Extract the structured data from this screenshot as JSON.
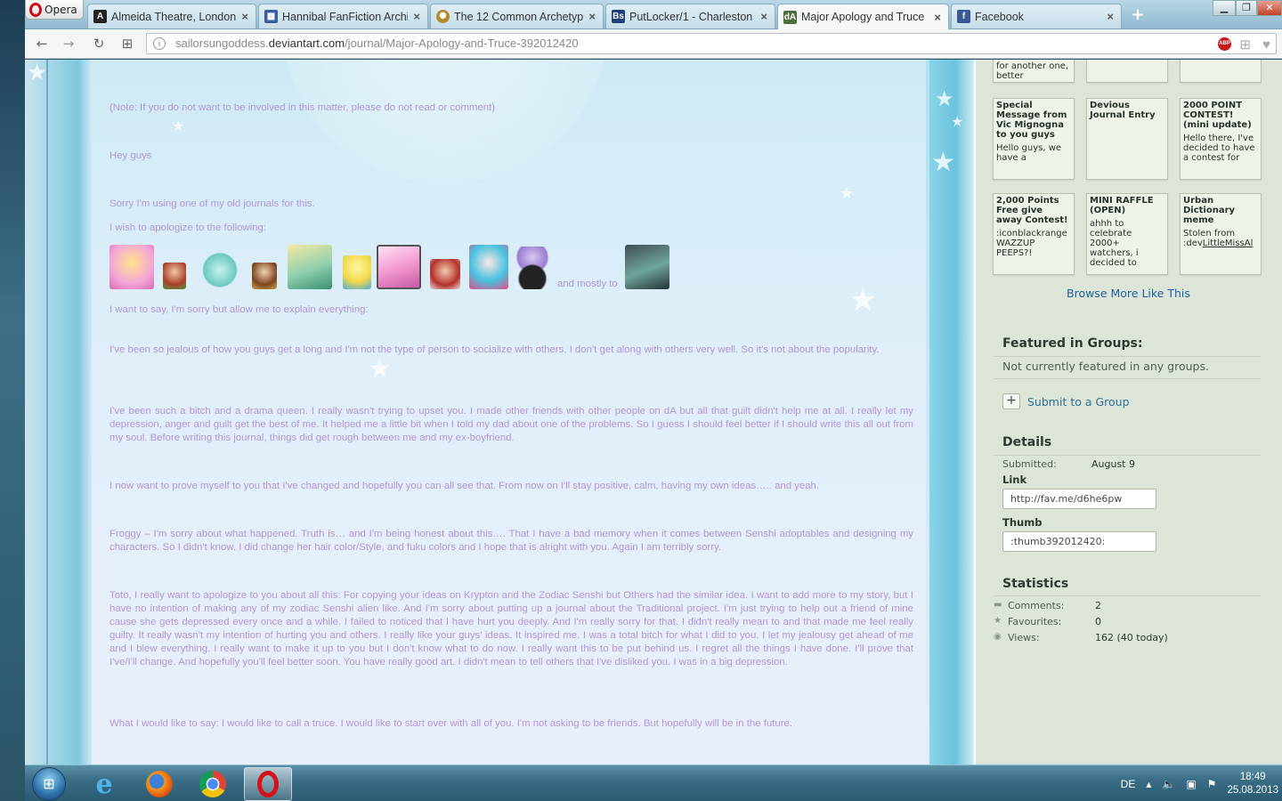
{
  "browser": {
    "menu_label": "Opera",
    "tabs": [
      {
        "title": "Almeida Theatre, London",
        "close": "×"
      },
      {
        "title": "Hannibal FanFiction Archive",
        "close": "×"
      },
      {
        "title": "The 12 Common Archetypes",
        "close": "×"
      },
      {
        "title": "PutLocker/1 - Charleston",
        "close": "×"
      },
      {
        "title": "Major Apology and Truce",
        "close": "×"
      },
      {
        "title": "Facebook",
        "close": "×"
      }
    ],
    "new_tab": "+",
    "url_prefix": "sailorsungoddess.",
    "url_domain": "deviantart.com",
    "url_path": "/journal/Major-Apology-and-Truce-392012420",
    "adblock_label": "ABP"
  },
  "journal": {
    "note": "(Note: If you do not want to be involved in this matter, please do not read or comment)",
    "greeting": "Hey guys",
    "p_old": "Sorry I'm using one of my old journals for this.",
    "p_wish": " I wish to apologize to the following:",
    "and_mostly": "and mostly to",
    "p_explain": "I want to say, I'm sorry but allow me to explain everything:",
    "p1": "I've been so jealous of how you guys get a long and I'm not the type of person to socialize with others. I don't get along with others very well. So it's not about the popularity.",
    "p2": "I've been such a bitch and a drama queen. I really wasn't trying to upset you. I made other friends with other people on dA but all that guilt didn't help me at all. I really let my depression, anger and guilt get the best of me. It helped me a little bit when I told my dad about one of the problems. So I guess I should feel better if I should write this all out from my soul. Before writing this journal, things did get rough between me and my ex-boyfriend.",
    "p3": "I now want to prove myself to you that I've changed and hopefully you can all see that. From now on I'll stay positive, calm, having my own ideas….. and yeah.",
    "p4": "Froggy – I'm sorry about what happened. Truth is… and I'm being honest about this…. That I have a bad memory when it comes between Senshi adoptables and designing my characters. So I didn't know. I did change her hair color/Style, and fuku colors and I hope that is alright with you. Again I am terribly sorry.",
    "p5": "Toto, I really want to apologize to you about all this: For copying your ideas on Krypton and the Zodiac Senshi but Others had the similar idea. I want to add more to my story, but I have no intention of making any of my zodiac Senshi alien like. And I'm sorry about putting up a journal about the Traditional project. I'm just trying to help out a friend of mine cause she gets depressed every once and a while. I failed to noticed that I have hurt you deeply. And I'm really sorry for that. I didn't really mean to and that made me feel really guilty. It really wasn't my intention of hurting you and others. I really like your guys' ideas. It inspired me. I was a total bitch for what I did to you. I let my jealousy get ahead of me and I blew everything. I really want to make it up to you but I don't know what to do now. I really want this to be put behind us. I regret all the things I have done. I'll prove that I've/I'll change. And hopefully you'll feel better soon. You have really good art. I didn't mean to tell others that I've disliked you. I was in a big depression.",
    "p6": "What I would like to say: I would like to call a truce. I would like to start over with all of you. I'm not asking to be friends. But hopefully will be in the future."
  },
  "sidebar": {
    "thumbs_top": [
      {
        "text": "for another one, better"
      },
      {
        "text": ""
      },
      {
        "text": ""
      }
    ],
    "thumbs": [
      {
        "title": "Special Message from Vic Mignogna to you guys",
        "text": "Hello guys, we have a"
      },
      {
        "title": "Devious Journal Entry",
        "text": ""
      },
      {
        "title": "2000 POINT CONTEST! (mini update)",
        "text": "Hello there, I've decided to have a contest for"
      },
      {
        "title": "2,000 Points Free give away Contest!",
        "text": ":iconblackrange WAZZUP PEEPS?!"
      },
      {
        "title": "MINI RAFFLE (OPEN)",
        "text": "ahhh to celebrate 2000+ watchers, i decided to"
      },
      {
        "title": "Urban Dictionary meme",
        "text": "Stolen from :dev",
        "link": "LittleMissAl"
      }
    ],
    "browse_more": "Browse More Like This",
    "featured_heading": "Featured in Groups:",
    "featured_text": "Not currently featured in any groups.",
    "submit_plus": "+",
    "submit_label": "Submit to a Group",
    "details_heading": "Details",
    "submitted_label": "Submitted:",
    "submitted_value": "August 9",
    "link_label": "Link",
    "link_value": "http://fav.me/d6he6pw",
    "thumb_label": "Thumb",
    "thumb_value": ":thumb392012420:",
    "stats_heading": "Statistics",
    "comments_label": "Comments:",
    "comments_value": "2",
    "favourites_label": "Favourites:",
    "favourites_value": "0",
    "views_label": "Views:",
    "views_value": "162 (40 today)"
  },
  "taskbar": {
    "lang": "DE",
    "time": "18:49",
    "date": "25.08.2013"
  },
  "colors": {
    "journal_text": "#b396d4",
    "link_blue": "#1f5fa0",
    "opera_red": "#cc0f16"
  }
}
